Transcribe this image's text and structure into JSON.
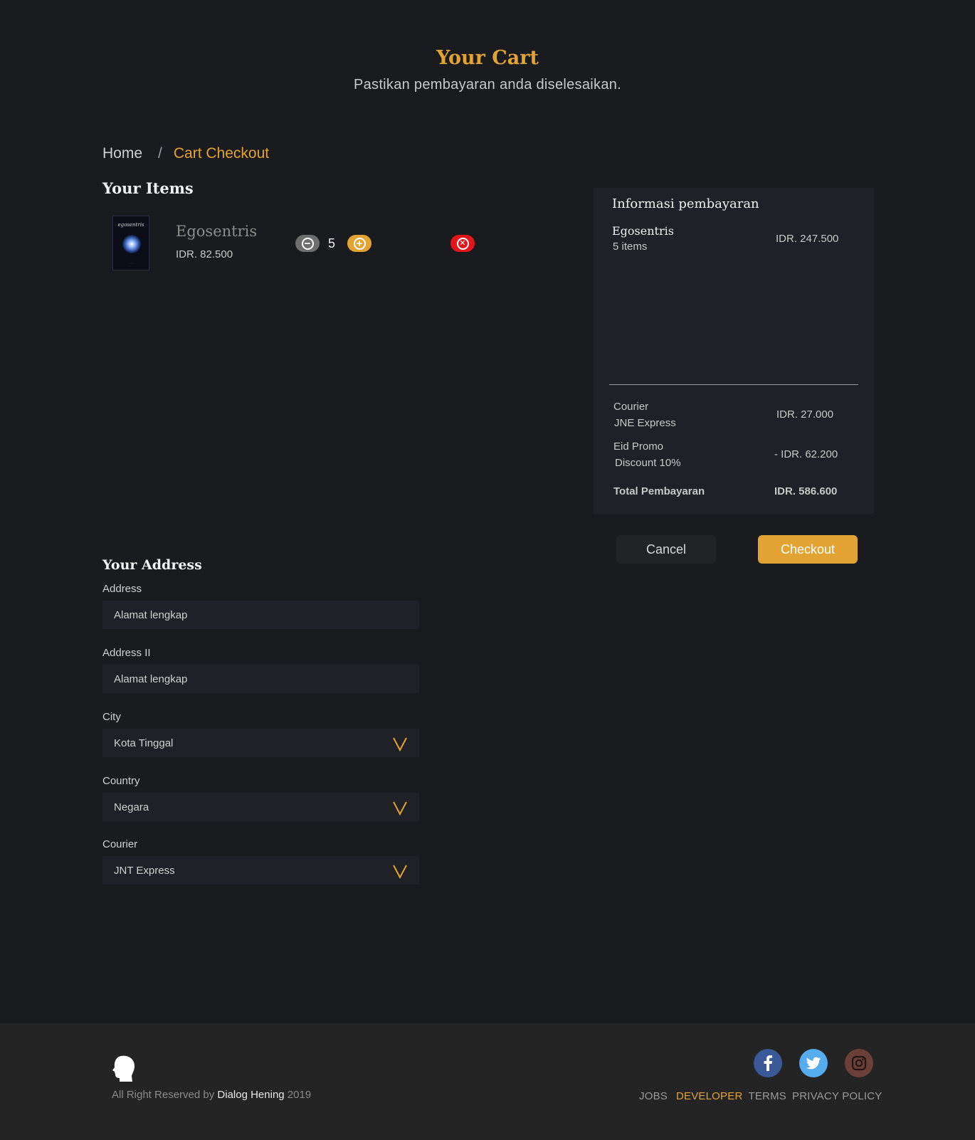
{
  "header": {
    "title": "Your Cart",
    "subtitle": "Pastikan pembayaran anda diselesaikan."
  },
  "breadcrumb": {
    "home": "Home",
    "separator": "/",
    "current": "Cart Checkout"
  },
  "items_section": {
    "title": "Your Items",
    "items": [
      {
        "name": "Egosentris",
        "price": "IDR. 82.500",
        "quantity": "5",
        "cover_title": "egosentris"
      }
    ]
  },
  "summary": {
    "title": "Informasi pembayaran",
    "lines": [
      {
        "name": "Egosentris",
        "qty": "5 items",
        "amount": "IDR. 247.500"
      }
    ],
    "courier_label": "Courier",
    "courier_name": "JNE Express",
    "courier_amount": "IDR. 27.000",
    "promo_label": "Eid Promo",
    "promo_detail": "Discount 10%",
    "promo_amount": "- IDR. 62.200",
    "total_label": "Total Pembayaran",
    "total_amount": "IDR. 586.600"
  },
  "actions": {
    "cancel_label": "Cancel",
    "checkout_label": "Checkout"
  },
  "address_section": {
    "title": "Your Address",
    "address_label": "Address",
    "address_placeholder": "Alamat lengkap",
    "address2_label": "Address II",
    "address2_placeholder": "Alamat lengkap",
    "city_label": "City",
    "city_value": "Kota Tinggal",
    "country_label": "Country",
    "country_value": "Negara",
    "courier_label": "Courier",
    "courier_value": "JNT Express"
  },
  "footer": {
    "copyright_prefix": "All Right Reserved by ",
    "brand": "Dialog Hening",
    "year": " 2019",
    "links": [
      "JOBS",
      "DEVELOPER",
      "TERMS",
      "PRIVACY POLICY"
    ],
    "social_icons": [
      "facebook-icon",
      "twitter-icon",
      "instagram-icon"
    ]
  },
  "colors": {
    "background": "#1a1b1f",
    "accent": "#e3a332",
    "panel": "#202126",
    "danger": "#e2151b",
    "footer": "#242424"
  }
}
